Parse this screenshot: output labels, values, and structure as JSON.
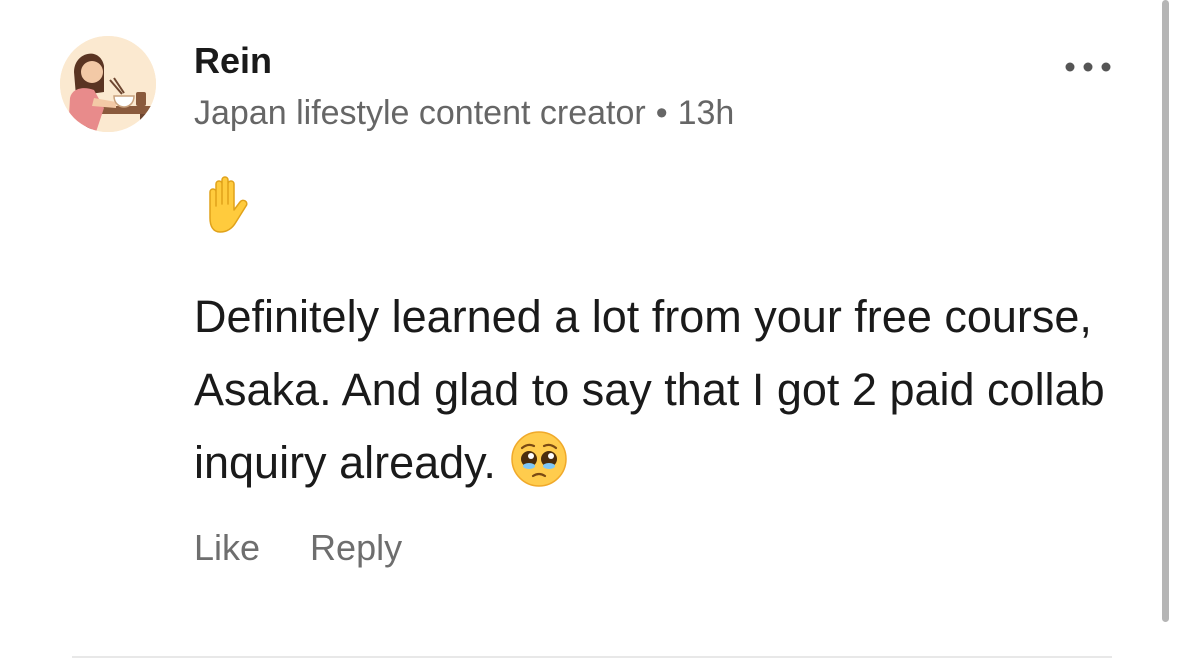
{
  "comment": {
    "author": "Rein",
    "headline": "Japan lifestyle content creator",
    "separator": "•",
    "time": "13h",
    "reaction_icon": "raised-hand-icon",
    "text": "Definitely learned a lot from your free course, Asaka. And glad to say that I got 2 paid collab inquiry already.",
    "trailing_emoji": "pleading-face-icon",
    "actions": {
      "like": "Like",
      "reply": "Reply"
    },
    "more_icon": "more-options-icon"
  },
  "colors": {
    "text": "#1a1a1a",
    "muted": "#666666",
    "scrollbar": "#b5b5b5"
  }
}
